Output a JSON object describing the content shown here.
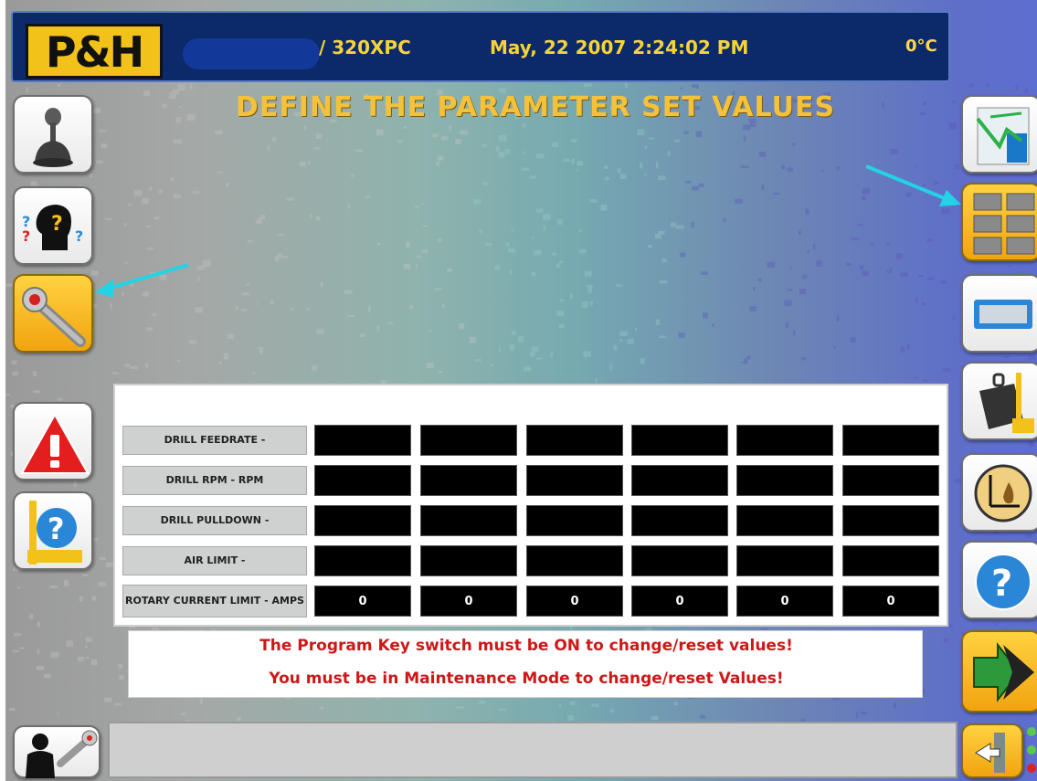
{
  "header": {
    "logo": "P&H",
    "machine": "/ 320XPC",
    "datetime": "May, 22 2007 2:24:02 PM",
    "temperature": "0°C"
  },
  "title": "DEFINE THE PARAMETER SET VALUES",
  "left_nav": [
    {
      "icon": "joystick-icon",
      "active": false
    },
    {
      "icon": "help-head-icon",
      "active": false
    },
    {
      "icon": "wrench-icon",
      "active": true
    },
    {
      "icon": "alarm-warning-icon",
      "active": false
    },
    {
      "icon": "drill-help-icon",
      "active": false
    }
  ],
  "right_nav": [
    {
      "icon": "map-trend-icon",
      "active": false
    },
    {
      "icon": "grid-view-icon",
      "active": true
    },
    {
      "icon": "panel-display-icon",
      "active": false
    },
    {
      "icon": "weight-icon",
      "active": false
    },
    {
      "icon": "leveling-icon",
      "active": false
    },
    {
      "icon": "help-icon",
      "active": false
    },
    {
      "icon": "next-arrow-icon",
      "active": true
    },
    {
      "icon": "exit-door-icon",
      "active": true
    }
  ],
  "parameters": [
    {
      "label": "DRILL FEEDRATE -",
      "values": [
        "",
        "",
        "",
        "",
        "",
        ""
      ]
    },
    {
      "label": "DRILL RPM - RPM",
      "values": [
        "",
        "",
        "",
        "",
        "",
        ""
      ]
    },
    {
      "label": "DRILL PULLDOWN -",
      "values": [
        "",
        "",
        "",
        "",
        "",
        ""
      ]
    },
    {
      "label": "AIR LIMIT -",
      "values": [
        "",
        "",
        "",
        "",
        "",
        ""
      ]
    },
    {
      "label": "ROTARY CURRENT LIMIT - AMPS",
      "values": [
        "0",
        "0",
        "0",
        "0",
        "0",
        "0"
      ]
    }
  ],
  "messages": {
    "line1": "The Program Key switch must be ON to change/reset values!",
    "line2": "You must be in Maintenance Mode to change/reset Values!"
  },
  "status_bar": {
    "operator_icon": "operator-wrench-icon",
    "text": ""
  },
  "colors": {
    "header_bg": "#0c2a6a",
    "header_text": "#f6d33b",
    "title": "#f3c23a",
    "active_button": "#f1a40f",
    "message_text": "#cc1818",
    "annotation_arrow": "#22d3e6"
  }
}
